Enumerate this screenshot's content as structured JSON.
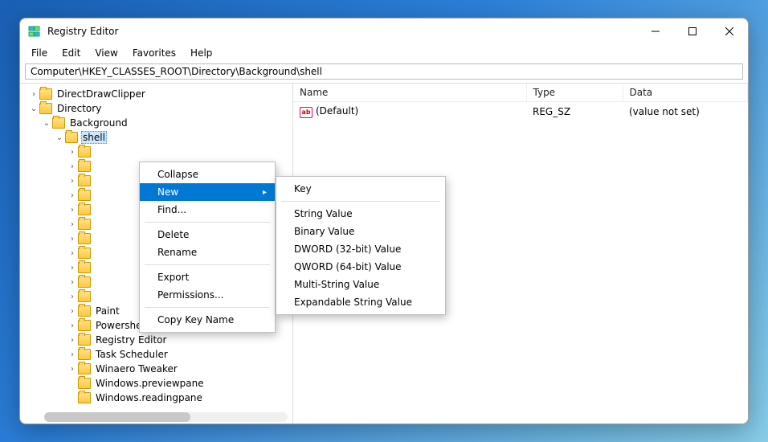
{
  "window": {
    "title": "Registry Editor"
  },
  "menubar": [
    "File",
    "Edit",
    "View",
    "Favorites",
    "Help"
  ],
  "address": "Computer\\HKEY_CLASSES_ROOT\\Directory\\Background\\shell",
  "columns": {
    "name": "Name",
    "type": "Type",
    "data": "Data"
  },
  "value_row": {
    "name": "(Default)",
    "type": "REG_SZ",
    "data": "(value not set)"
  },
  "tree": {
    "direct_draw": "DirectDrawClipper",
    "directory": "Directory",
    "background": "Background",
    "shell": "shell",
    "after_shell": [
      "Paint",
      "Powershell",
      "Registry Editor",
      "Task Scheduler",
      "Winaero Tweaker",
      "Windows.previewpane",
      "Windows.readingpane"
    ]
  },
  "context_menu": {
    "collapse": "Collapse",
    "new": "New",
    "find": "Find...",
    "delete": "Delete",
    "rename": "Rename",
    "export": "Export",
    "permissions": "Permissions...",
    "copy_key": "Copy Key Name"
  },
  "submenu": {
    "key": "Key",
    "string": "String Value",
    "binary": "Binary Value",
    "dword": "DWORD (32-bit) Value",
    "qword": "QWORD (64-bit) Value",
    "multi": "Multi-String Value",
    "expand": "Expandable String Value"
  }
}
